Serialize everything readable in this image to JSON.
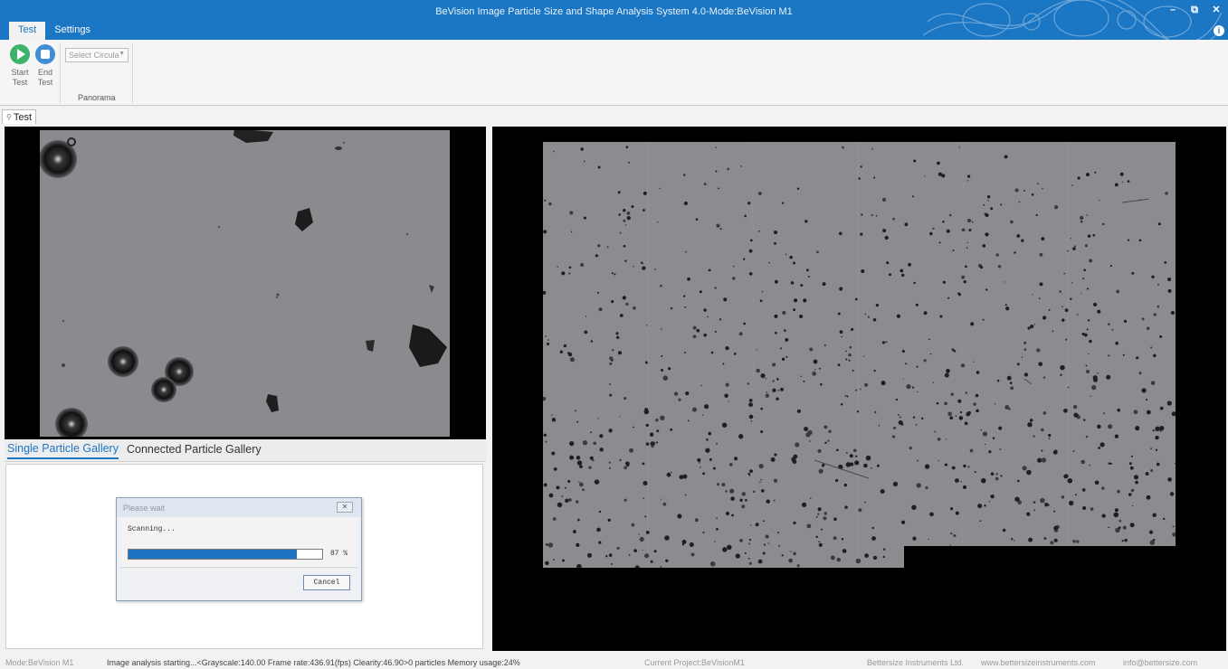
{
  "window": {
    "title": "BeVision Image Particle Size and Shape Analysis System 4.0-Mode:BeVision M1",
    "controls": {
      "minimize": "–",
      "restore": "⧉",
      "close": "✕",
      "info": "i"
    }
  },
  "tabs": [
    {
      "label": "Test",
      "active": true
    },
    {
      "label": "Settings",
      "active": false
    }
  ],
  "ribbon": {
    "start_test": "Start Test",
    "end_test": "End Test",
    "select_placeholder": "Select Circula",
    "group_label": "Panorama"
  },
  "document_tab": {
    "label": "Test"
  },
  "gallery_tabs": [
    {
      "label": "Single Particle Gallery",
      "active": true
    },
    {
      "label": "Connected Particle Gallery",
      "active": false
    }
  ],
  "dialog": {
    "title": "Please wait",
    "message": "Scanning...",
    "progress": 87,
    "progress_label": "87 %",
    "cancel_label": "Cancel"
  },
  "statusbar": {
    "mode": "Mode:BeVision M1",
    "message": "Image analysis starting...<Grayscale:140.00 Frame rate:436.91(fps) Clearity:46.90>0 particles Memory usage:24%",
    "project": "Current Project:BeVisionM1",
    "company": "Bettersize Instruments Ltd.",
    "website": "www.bettersizeinstruments.com",
    "email": "info@bettersize.com"
  },
  "colors": {
    "accent": "#1b76c4",
    "start_button": "#3bb36a",
    "end_button": "#3e8fd6"
  }
}
